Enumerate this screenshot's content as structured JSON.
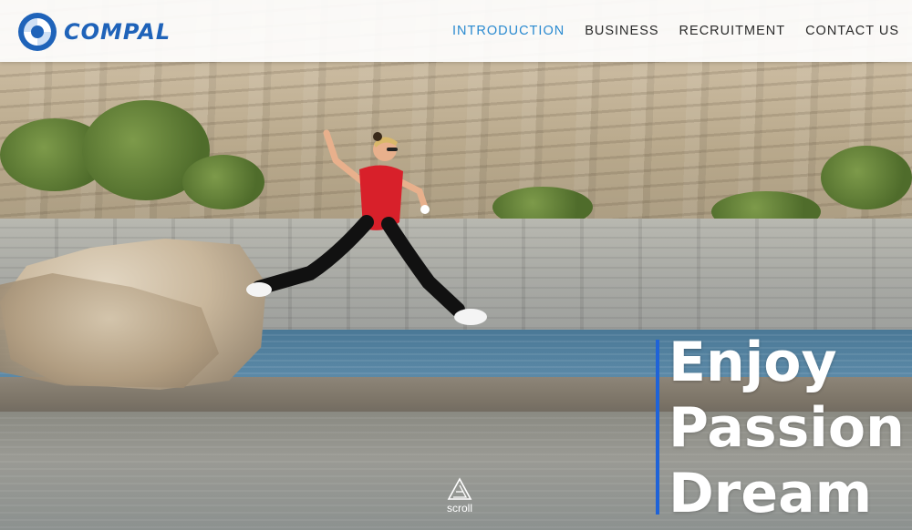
{
  "brand": {
    "name": "COMPAL",
    "logo_icon": "compal-swirl-logo-icon",
    "color": "#1f63b9"
  },
  "nav": {
    "items": [
      {
        "label": "INTRODUCTION",
        "active": true
      },
      {
        "label": "BUSINESS",
        "active": false
      },
      {
        "label": "RECRUITMENT",
        "active": false
      },
      {
        "label": "CONTACT US",
        "active": false
      }
    ],
    "active_color": "#2a8ad0"
  },
  "hero": {
    "slogan": [
      "Enjoy",
      "Passion",
      "Dream"
    ],
    "accent_color": "#1f63d8",
    "image_subject": "runner-leaping-over-lake-photo"
  },
  "scroll_hint": {
    "label": "scroll",
    "icon": "scroll-triangle-icon"
  }
}
